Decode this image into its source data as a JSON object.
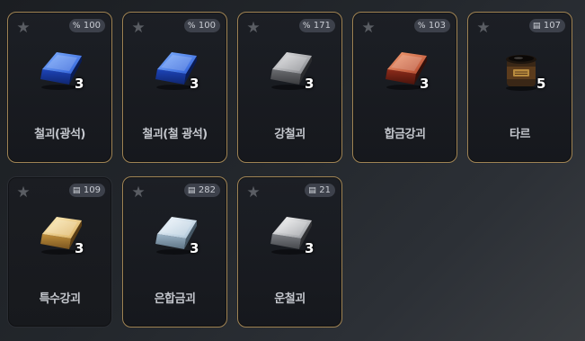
{
  "inventory": {
    "items": [
      {
        "name": "철괴(광석)",
        "quantity": "3",
        "badge_icon": "mix-icon",
        "badge_value": "100",
        "image": "blue-ingot-icon",
        "highlighted": true
      },
      {
        "name": "철괴(철 광석)",
        "quantity": "3",
        "badge_icon": "mix-icon",
        "badge_value": "100",
        "image": "blue-ingot-icon",
        "highlighted": true
      },
      {
        "name": "강철괴",
        "quantity": "3",
        "badge_icon": "mix-icon",
        "badge_value": "171",
        "image": "steel-ingot-icon",
        "highlighted": true
      },
      {
        "name": "합금강괴",
        "quantity": "3",
        "badge_icon": "mix-icon",
        "badge_value": "103",
        "image": "alloy-ingot-icon",
        "highlighted": true
      },
      {
        "name": "타르",
        "quantity": "5",
        "badge_icon": "storage-icon",
        "badge_value": "107",
        "image": "tar-jar-icon",
        "highlighted": true
      },
      {
        "name": "특수강괴",
        "quantity": "3",
        "badge_icon": "storage-icon",
        "badge_value": "109",
        "image": "gold-ingot-icon",
        "highlighted": false
      },
      {
        "name": "은합금괴",
        "quantity": "3",
        "badge_icon": "storage-icon",
        "badge_value": "282",
        "image": "silver-ingot-icon",
        "highlighted": true
      },
      {
        "name": "운철괴",
        "quantity": "3",
        "badge_icon": "storage-icon",
        "badge_value": "21",
        "image": "meteor-ingot-icon",
        "highlighted": true
      }
    ]
  },
  "colors": {
    "frame_gold": "#a08454",
    "badge_bg": "#3d414b",
    "name_text": "#c4c7cd"
  }
}
